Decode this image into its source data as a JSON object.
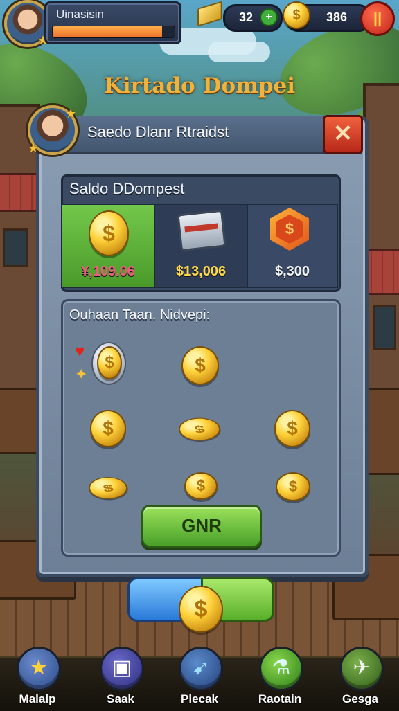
{
  "hud": {
    "player_name": "Uinasisin",
    "xp_progress": 0.9,
    "gold_bars": "32",
    "coins": "386",
    "pause_glyph": "||"
  },
  "game_title": "Kirtado Dompei",
  "dialog": {
    "title": "Saedo Dlanr Rtraidst",
    "close_glyph": "✕",
    "balance": {
      "label": "Saldo DDompest",
      "tiles": [
        {
          "icon": "gold-coin-icon",
          "amount": "¥,109.06",
          "color": "#5fb339"
        },
        {
          "icon": "treasure-chest-icon",
          "amount": "$13,006",
          "color": "#2e3c55"
        },
        {
          "icon": "gem-icon",
          "amount": "$,300",
          "color": "#3a4a66"
        }
      ]
    },
    "rewards": {
      "label": "Ouhaan Taan. Nidvepi:"
    },
    "confirm_button": "GNR"
  },
  "nav": [
    {
      "label": "Malalp",
      "icon": "star-icon"
    },
    {
      "label": "Saak",
      "icon": "shop-chest-icon"
    },
    {
      "label": "Plecak",
      "icon": "arrow-shield-icon"
    },
    {
      "label": "Raotain",
      "icon": "potion-icon"
    },
    {
      "label": "Gesga",
      "icon": "rocket-icon"
    }
  ]
}
